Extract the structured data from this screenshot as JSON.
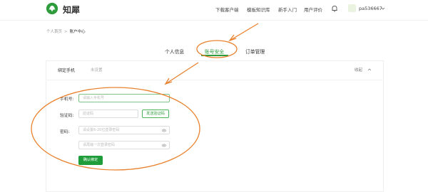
{
  "header": {
    "logo_text": "知犀",
    "nav": [
      "下载客户端",
      "模板知识库",
      "新手入门",
      "用户评价"
    ],
    "username": "pa536667"
  },
  "breadcrumb": {
    "home": "个人首页",
    "separator": ">",
    "current": "账户中心"
  },
  "tabs": [
    {
      "label": "个人信息",
      "active": false
    },
    {
      "label": "账号安全",
      "active": true
    },
    {
      "label": "订单管理",
      "active": false
    }
  ],
  "section": {
    "title": "绑定手机",
    "status": "未设置",
    "collapse_label": "收起"
  },
  "form": {
    "phone_label": "手机号:",
    "phone_placeholder": "请输入手机号",
    "code_label": "验证码:",
    "code_placeholder": "验证码",
    "send_code_label": "发送验证码",
    "password_label": "密码:",
    "password_placeholder": "请设置6-20位登录密码",
    "confirm_placeholder": "请再输一次登录密码",
    "submit_label": "确认绑定"
  },
  "colors": {
    "accent": "#2e9b3c",
    "button": "#1f9d3a",
    "annotation": "#e9822f"
  },
  "icons": [
    "logo-leaf-icon",
    "bell-icon",
    "chevron-down-icon",
    "chevron-up-icon",
    "eye-icon"
  ]
}
